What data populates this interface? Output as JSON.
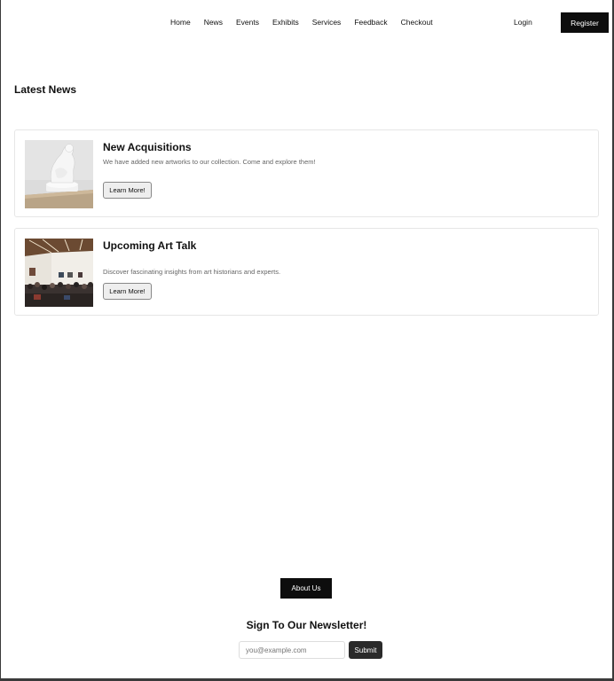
{
  "nav": {
    "items": [
      {
        "label": "Home"
      },
      {
        "label": "News"
      },
      {
        "label": "Events"
      },
      {
        "label": "Exhibits"
      },
      {
        "label": "Services"
      },
      {
        "label": "Feedback"
      },
      {
        "label": "Checkout"
      }
    ],
    "login_label": "Login",
    "register_label": "Register"
  },
  "main": {
    "section_title": "Latest News",
    "news": [
      {
        "title": "New Acquisitions",
        "description": "We have added new artworks to our collection. Come and explore them!",
        "button_label": "Learn More!",
        "image": "sculpture-photo"
      },
      {
        "title": "Upcoming Art Talk",
        "description": "Discover fascinating insights from art historians and experts.",
        "button_label": "Learn More!",
        "image": "gallery-crowd-photo"
      }
    ]
  },
  "footer": {
    "about_label": "About Us",
    "newsletter_title": "Sign To Our Newsletter!",
    "email_placeholder": "you@example.com",
    "submit_label": "Submit"
  },
  "colors": {
    "button_dark": "#0d0d0d",
    "card_border": "#e6e6e6",
    "muted_text": "#666666"
  }
}
